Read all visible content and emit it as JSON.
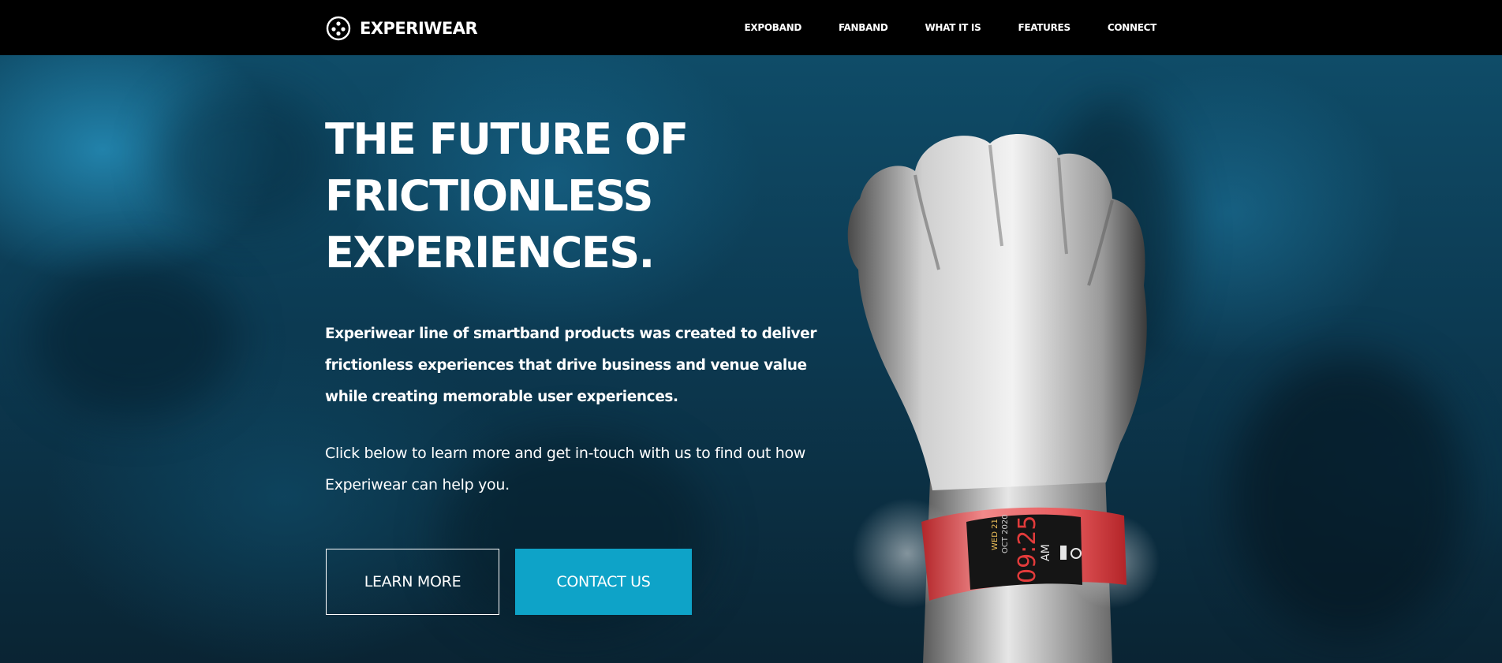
{
  "brand": {
    "name": "EXPERIWEAR",
    "icon": "dots-circle-icon"
  },
  "nav": {
    "items": [
      {
        "label": "EXPOBAND"
      },
      {
        "label": "FANBAND"
      },
      {
        "label": "WHAT IT IS"
      },
      {
        "label": "FEATURES"
      },
      {
        "label": "CONNECT"
      }
    ]
  },
  "hero": {
    "headline_lines": [
      "THE FUTURE OF",
      "FRICTIONLESS",
      "EXPERIENCES."
    ],
    "intro": "Experiwear line of smartband products was created to deliver frictionless experiences that drive business and venue value while creating memorable user experiences.",
    "cta_text": "Click below to learn more and get in-touch with us to find out how Experiwear can help you.",
    "buttons": {
      "learn_more": "LEARN MORE",
      "contact_us": "CONTACT US"
    },
    "band_display": {
      "day": "WED 21",
      "date": "OCT 2020",
      "time": "09:25",
      "ampm": "AM"
    }
  },
  "colors": {
    "nav_bg": "#000000",
    "accent": "#0ea3c8",
    "band_red": "#e23b3b",
    "text": "#ffffff"
  }
}
